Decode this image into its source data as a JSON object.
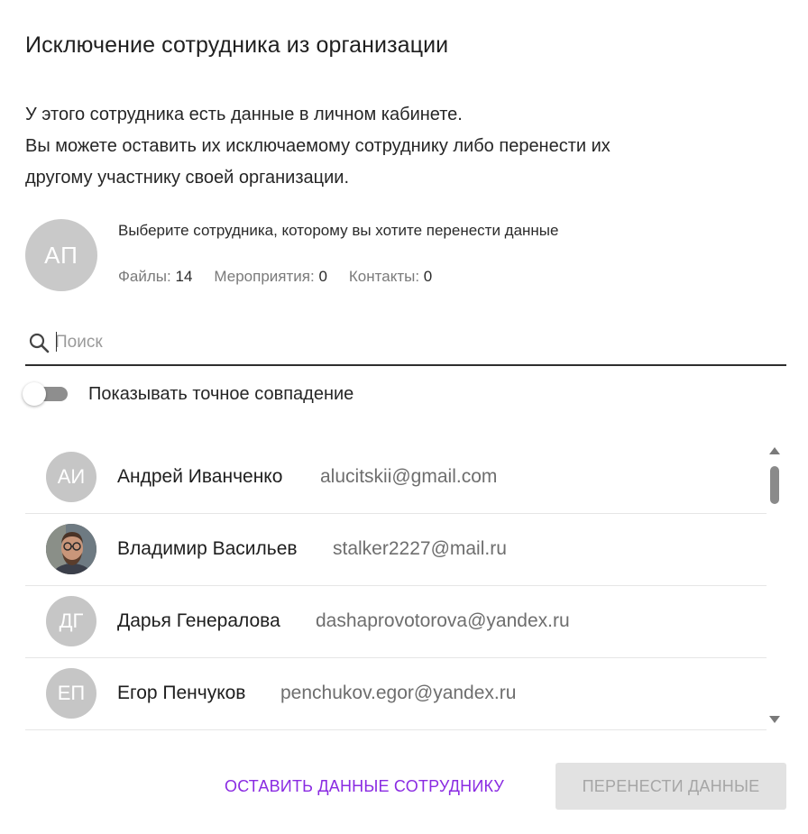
{
  "dialog": {
    "title": "Исключение сотрудника из организации",
    "description": [
      "У этого сотрудника есть данные в личном кабинете.",
      "Вы можете оставить их исключаемому сотруднику либо перенести их",
      "другому участнику своей организации."
    ]
  },
  "owner": {
    "initials": "АП",
    "prompt": "Выберите сотрудника, которому вы хотите перенести данные",
    "stats": [
      {
        "label": "Файлы:",
        "value": "14"
      },
      {
        "label": "Мероприятия:",
        "value": "0"
      },
      {
        "label": "Контакты:",
        "value": "0"
      }
    ]
  },
  "search": {
    "placeholder": "Поиск",
    "value": "",
    "icon": "search-icon"
  },
  "exact_match_toggle": {
    "label": "Показывать точное совпадение",
    "checked": false
  },
  "employees": [
    {
      "initials": "АИ",
      "name": "Андрей Иванченко",
      "email": "alucitskii@gmail.com",
      "has_photo": false
    },
    {
      "initials": "",
      "name": "Владимир Васильев",
      "email": "stalker2227@mail.ru",
      "has_photo": true
    },
    {
      "initials": "ДГ",
      "name": "Дарья Генералова",
      "email": "dashaprovotorova@yandex.ru",
      "has_photo": false
    },
    {
      "initials": "ЕП",
      "name": "Егор Пенчуков",
      "email": "penchukov.egor@yandex.ru",
      "has_photo": false
    }
  ],
  "buttons": {
    "keep_label": "ОСТАВИТЬ ДАННЫЕ СОТРУДНИКУ",
    "transfer_label": "ПЕРЕНЕСТИ ДАННЫЕ",
    "transfer_disabled": true
  },
  "colors": {
    "accent": "#8a2be2",
    "avatar_bg": "#c6c6c6",
    "disabled_bg": "#e2e2e2"
  }
}
